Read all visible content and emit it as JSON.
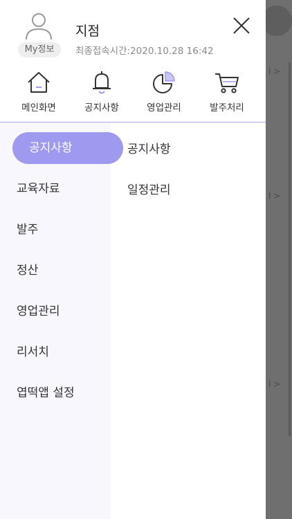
{
  "profile": {
    "my_info_label": "My정보",
    "branch_name": "지점",
    "last_login": "최종접속시간:2020.10.28 16:42"
  },
  "quick_menu": [
    {
      "label": "메인화면",
      "icon": "home-icon"
    },
    {
      "label": "공지사항",
      "icon": "bell-icon"
    },
    {
      "label": "영업관리",
      "icon": "pie-chart-icon"
    },
    {
      "label": "발주처리",
      "icon": "cart-icon"
    }
  ],
  "menu": {
    "active": "공지사항",
    "left_items": [
      "교육자료",
      "발주",
      "정산",
      "영업관리",
      "리서치",
      "엽떡앱 설정"
    ],
    "sub_items": [
      "공지사항",
      "일정관리"
    ]
  },
  "colors": {
    "accent": "#9d9af0",
    "divider": "#a9a8ee",
    "left_panel_bg": "#f8f7fd",
    "backdrop": "#6f6f6f"
  }
}
